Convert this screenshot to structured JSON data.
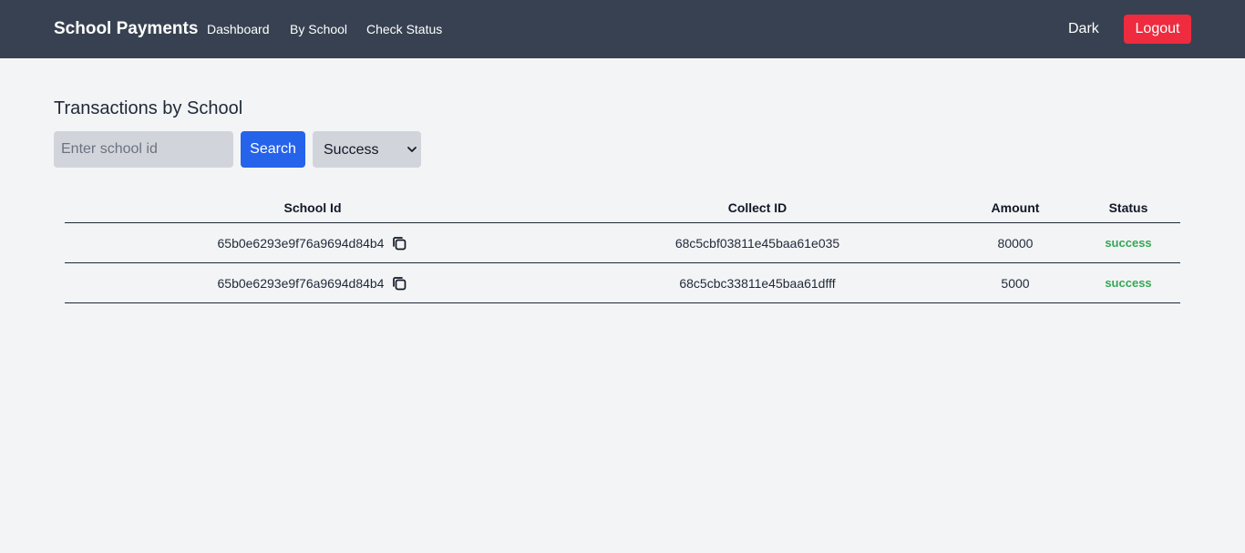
{
  "navbar": {
    "brand": "School Payments",
    "links": [
      "Dashboard",
      "By School",
      "Check Status"
    ],
    "theme_toggle": "Dark",
    "logout": "Logout"
  },
  "page": {
    "title": "Transactions by School"
  },
  "search": {
    "placeholder": "Enter school id",
    "value": "",
    "button": "Search",
    "status_filter": "Success"
  },
  "table": {
    "headers": [
      "School Id",
      "Collect ID",
      "Amount",
      "Status"
    ],
    "rows": [
      {
        "school_id": "65b0e6293e9f76a9694d84b4",
        "collect_id": "68c5cbf03811e45baa61e035",
        "amount": "80000",
        "status": "success"
      },
      {
        "school_id": "65b0e6293e9f76a9694d84b4",
        "collect_id": "68c5cbc33811e45baa61dfff",
        "amount": "5000",
        "status": "success"
      }
    ]
  },
  "colors": {
    "navbar_bg": "#374151",
    "logout_bg": "#ef2b3f",
    "search_bg": "#2563eb",
    "status_success": "#34a853"
  }
}
